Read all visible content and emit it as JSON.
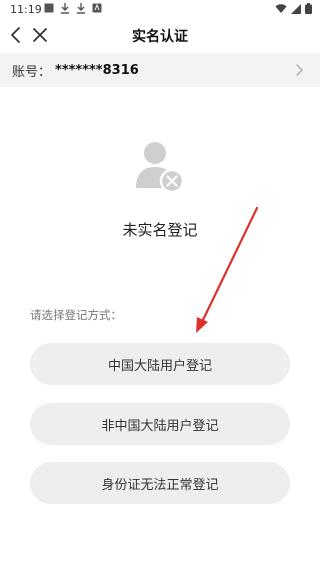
{
  "status_bar": {
    "time": "11:19"
  },
  "nav": {
    "title": "实名认证"
  },
  "account": {
    "label": "账号：",
    "value": "*******8316"
  },
  "main": {
    "status_title": "未实名登记",
    "choose_label": "请选择登记方式：",
    "options": [
      {
        "label": "中国大陆用户登记"
      },
      {
        "label": "非中国大陆用户登记"
      },
      {
        "label": "身份证无法正常登记"
      }
    ]
  },
  "colors": {
    "accent_arrow": "#e0302b",
    "pill_bg": "#eeeeee",
    "account_bg": "#f3f3f3",
    "avatar_gray": "#cfcfcf"
  },
  "icons": [
    "back-icon",
    "close-icon",
    "chevron-right-icon",
    "unverified-user-icon",
    "wifi-icon",
    "signal-icon",
    "battery-icon"
  ]
}
